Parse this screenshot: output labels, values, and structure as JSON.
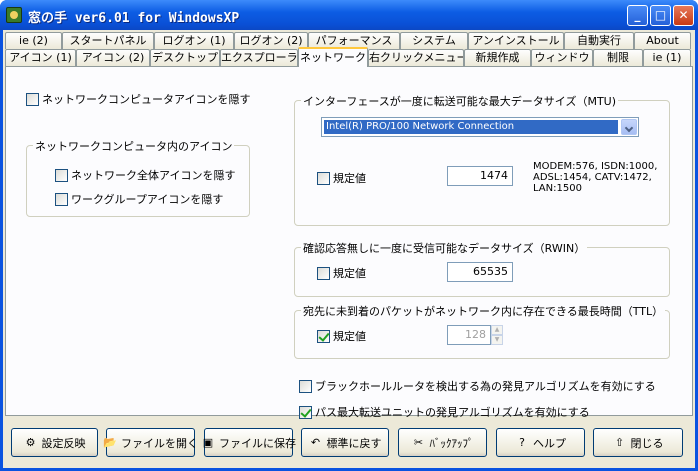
{
  "window": {
    "title": "窓の手 ver6.01 for WindowsXP"
  },
  "title_buttons": {
    "minimize": "_",
    "maximize": "□",
    "close": "✕"
  },
  "tabs_row1": [
    "ie (2)",
    "スタートパネル",
    "ログオン (1)",
    "ログオン (2)",
    "パフォーマンス",
    "システム",
    "アンインストール",
    "自動実行",
    "About"
  ],
  "tabs_row2": [
    "アイコン (1)",
    "アイコン (2)",
    "デスクトップ",
    "エクスプローラ",
    "ネットワーク",
    "右クリックメニュー",
    "新規作成",
    "ウィンドウ",
    "制限",
    "ie (1)"
  ],
  "active_tab": "ネットワーク",
  "left": {
    "hide_network_computer": {
      "label": "ネットワークコンピュータアイコンを隠す",
      "checked": false
    },
    "group_title": "ネットワークコンピュータ内のアイコン",
    "hide_entire_network": {
      "label": "ネットワーク全体アイコンを隠す",
      "checked": false
    },
    "hide_workgroup": {
      "label": "ワークグループアイコンを隠す",
      "checked": false
    }
  },
  "mtu": {
    "group_title": "インターフェースが一度に転送可能な最大データサイズ（MTU)",
    "adapter": "Intel(R) PRO/100 Network Connection",
    "default_label": "規定値",
    "default_checked": false,
    "value": "1474",
    "note": "MODEM:576, ISDN:1000,\nADSL:1454, CATV:1472,\nLAN:1500"
  },
  "rwin": {
    "group_title": "確認応答無しに一度に受信可能なデータサイズ（RWIN）",
    "default_label": "規定値",
    "default_checked": false,
    "value": "65535"
  },
  "ttl": {
    "group_title": "宛先に未到着のパケットがネットワーク内に存在できる最長時間（TTL）",
    "default_label": "規定値",
    "default_checked": true,
    "value": "128"
  },
  "options": {
    "blackhole": {
      "label": "ブラックホールルータを検出する為の発見アルゴリズムを有効にする",
      "checked": false
    },
    "pmtu": {
      "label": "パス最大転送ユニットの発見アルゴリズムを有効にする",
      "checked": true
    }
  },
  "buttons": {
    "apply": {
      "label": "設定反映",
      "icon": "settings-icon"
    },
    "open": {
      "label": "ファイルを開く",
      "icon": "folder-open-icon"
    },
    "save": {
      "label": "ファイルに保存",
      "icon": "floppy-icon"
    },
    "restore": {
      "label": "標準に戻す",
      "icon": "undo-icon"
    },
    "backup": {
      "label": "ﾊﾞｯｸｱｯﾌﾟ",
      "icon": "backup-icon"
    },
    "help": {
      "label": "ヘルプ",
      "icon": "help-icon"
    },
    "close": {
      "label": "閉じる",
      "icon": "close-folder-icon"
    }
  },
  "colors": {
    "title_bar": "#0a53e0",
    "selection": "#316ac5",
    "active_tab_accent": "#ffc83c",
    "face": "#ece9d8"
  }
}
